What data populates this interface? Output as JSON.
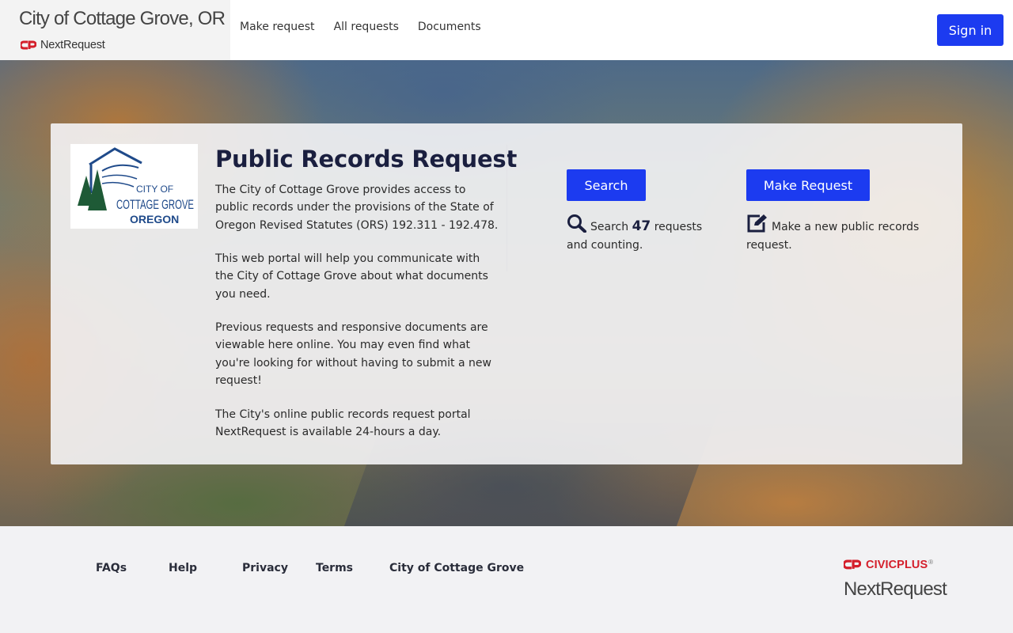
{
  "header": {
    "city_name": "City of Cottage Grove, OR",
    "product_name": "NextRequest",
    "nav": [
      "Make request",
      "All requests",
      "Documents"
    ],
    "signin_label": "Sign in"
  },
  "card": {
    "logo_lines": [
      "CITY OF",
      "COTTAGE GROVE",
      "OREGON"
    ],
    "title": "Public Records Request",
    "paragraphs": [
      "The City of Cottage Grove provides access to public records under the provisions of the State of Oregon Revised Statutes (ORS) 192.311 - 192.478.",
      "This web portal will help you communicate with the City of Cottage Grove about what documents you need.",
      "Previous requests and responsive documents are viewable here online. You may even find what you're looking for without having to submit a new request!",
      "The City's online public records request portal NextRequest is available 24-hours a day."
    ],
    "search": {
      "button_label": "Search",
      "prefix": "Search",
      "count": "47",
      "suffix": "requests and counting."
    },
    "make": {
      "button_label": "Make Request",
      "description": "Make a new public records request."
    }
  },
  "footer": {
    "links": [
      "FAQs",
      "Help",
      "Privacy",
      "Terms",
      "City of Cottage Grove"
    ],
    "civicplus_label": "CIVICPLUS",
    "trademark": "®",
    "product_name": "NextRequest"
  },
  "colors": {
    "primary": "#1c3bf0",
    "title": "#1a1f3f",
    "brand_red": "#d41f2b",
    "logo_blue": "#1f4a8a",
    "logo_green": "#1e5a36"
  },
  "icons": [
    "nextrequest-logo-icon",
    "search-icon",
    "edit-icon",
    "civicplus-logo-icon"
  ]
}
